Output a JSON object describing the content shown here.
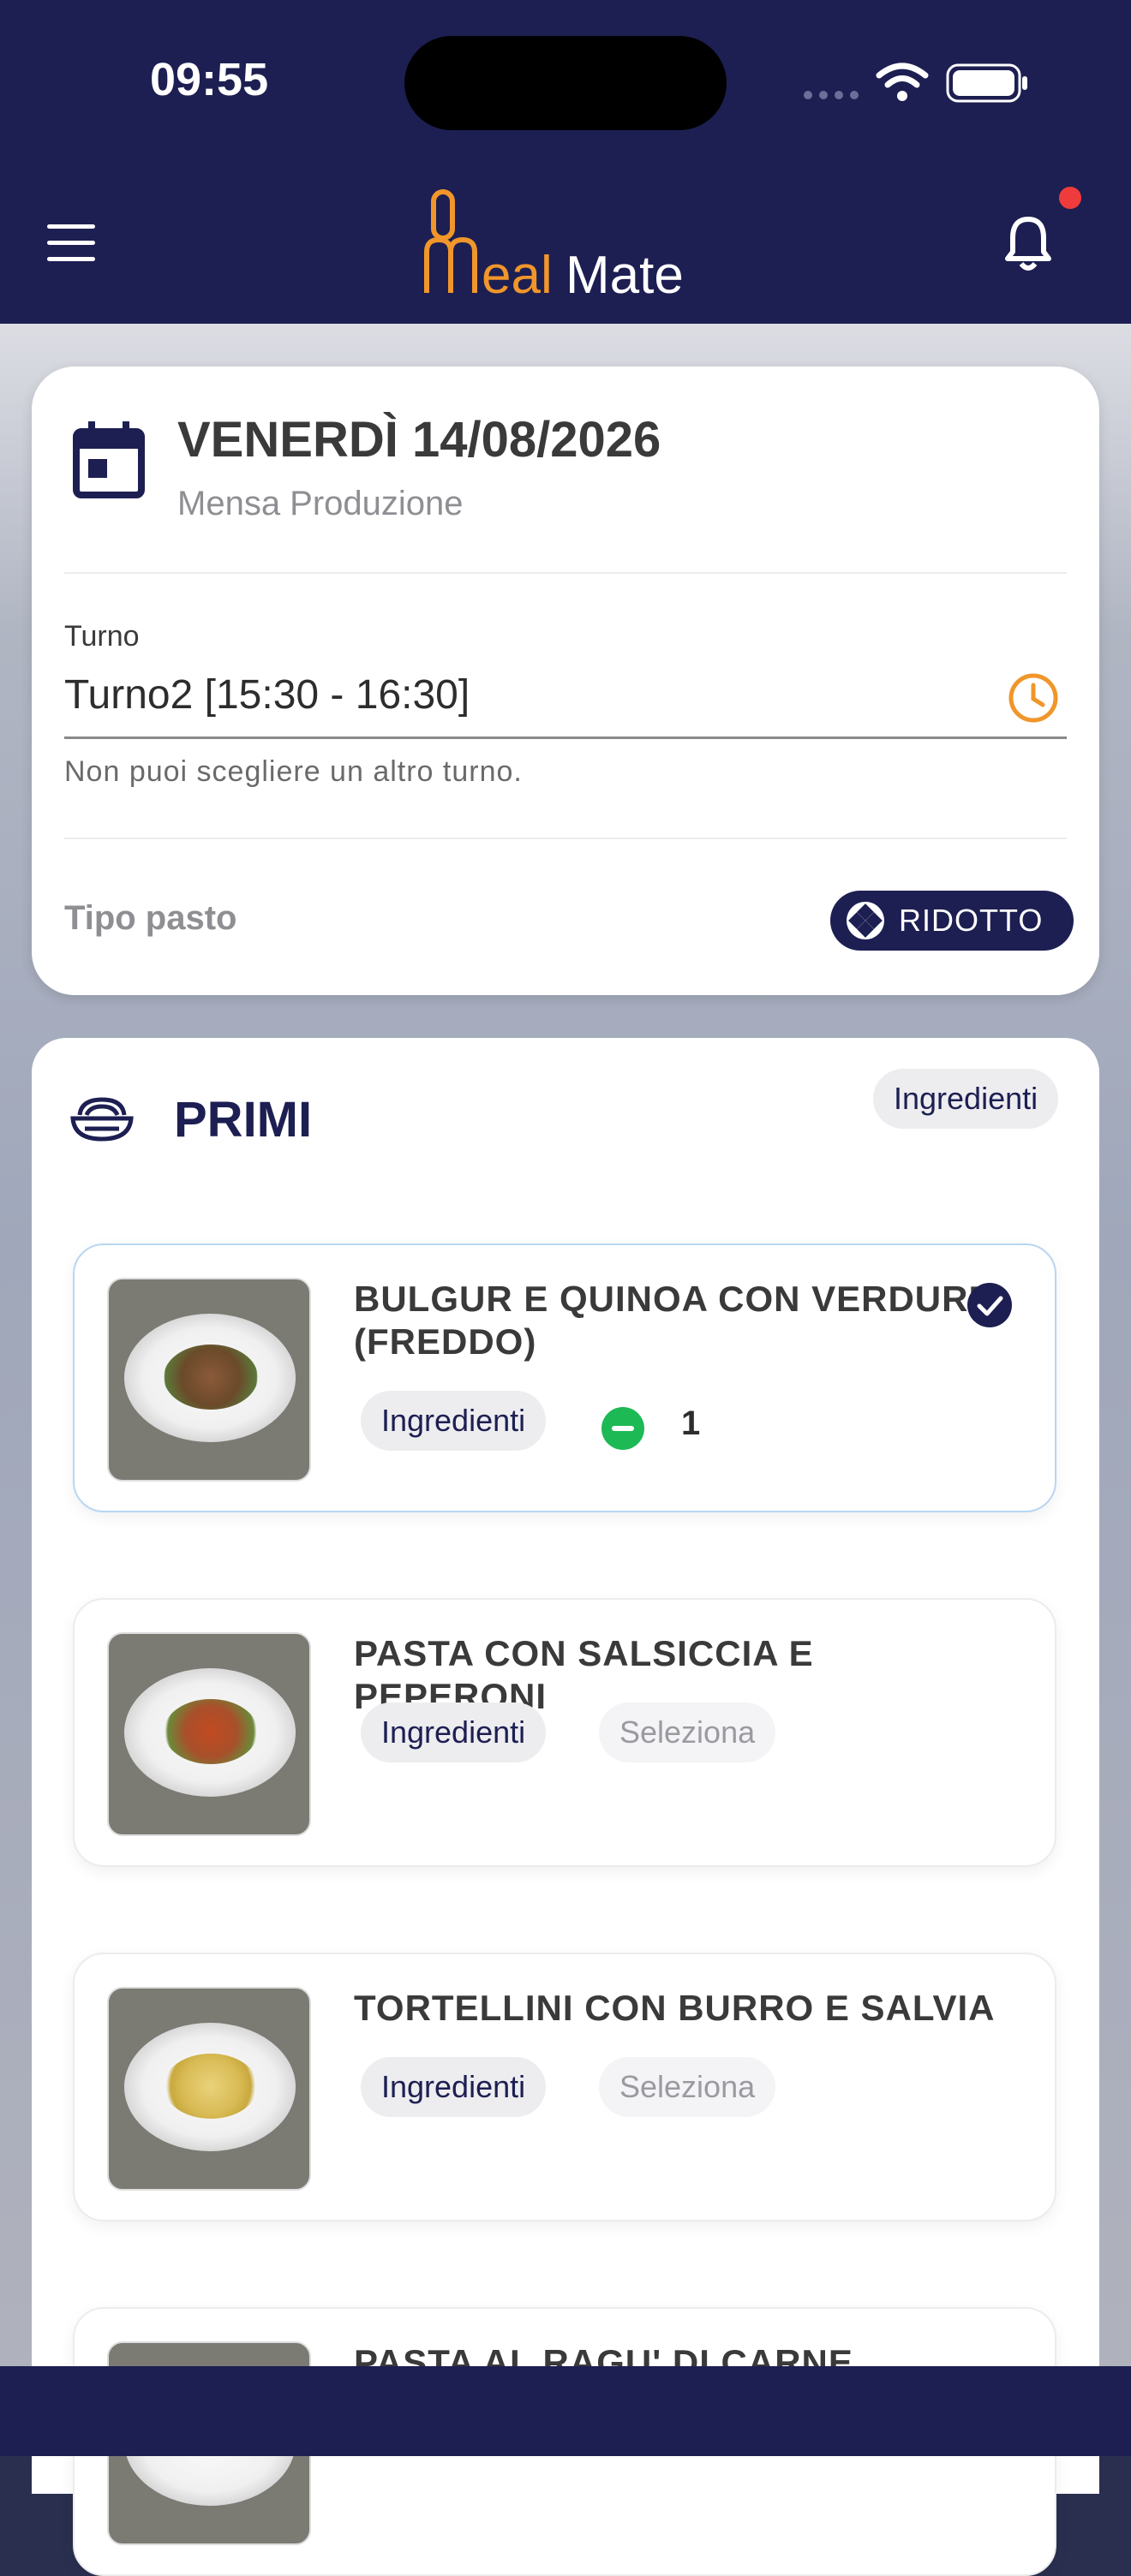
{
  "status_bar": {
    "time": "09:55"
  },
  "header": {
    "logo_text": "MealMate"
  },
  "date_card": {
    "date": "VENERDÌ 14/08/2026",
    "cafeteria": "Mensa Produzione",
    "shift_label": "Turno",
    "shift_value": "Turno2 [15:30 - 16:30]",
    "shift_helper": "Non puoi scegliere un altro turno.",
    "meal_type_label": "Tipo pasto",
    "meal_type_value": "RIDOTTO"
  },
  "section": {
    "title": "PRIMI",
    "ingredients_label": "Ingredienti",
    "dishes": [
      {
        "name": "BULGUR E QUINOA CON VERDURE (FREDDO)",
        "ingredients_label": "Ingredienti",
        "quantity": "1",
        "selected": true
      },
      {
        "name": "PASTA CON SALSICCIA E PEPERONI",
        "ingredients_label": "Ingredienti",
        "select_label": "Seleziona"
      },
      {
        "name": "TORTELLINI CON BURRO E SALVIA",
        "ingredients_label": "Ingredienti",
        "select_label": "Seleziona"
      },
      {
        "name": "PASTA AL RAGU' DI CARNE"
      }
    ]
  },
  "colors": {
    "navy": "#1d1f52",
    "accent_orange": "#f0962a",
    "selected_green": "#1db954",
    "notification_red": "#ef3b3b"
  }
}
